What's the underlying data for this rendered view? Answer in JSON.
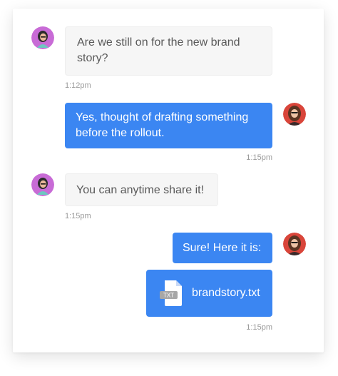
{
  "messages": [
    {
      "id": 1,
      "sender": "contact",
      "text": "Are we still on for the new brand story?",
      "time": "1:12pm"
    },
    {
      "id": 2,
      "sender": "me",
      "text": "Yes, thought of drafting something before the rollout.",
      "time": "1:15pm"
    },
    {
      "id": 3,
      "sender": "contact",
      "text": "You can anytime share it!",
      "time": "1:15pm"
    },
    {
      "id": 4,
      "sender": "me",
      "text": "Sure! Here it is:",
      "time": ""
    },
    {
      "id": 5,
      "sender": "me",
      "attachment": {
        "icon": "txt-file-icon",
        "badge": "TXT",
        "name": "brandstory.txt"
      },
      "time": "1:15pm"
    }
  ],
  "colors": {
    "outgoing_bubble": "#3b86f2",
    "incoming_bubble": "#f6f6f6",
    "incoming_text": "#595959",
    "timestamp": "#9a9a9a"
  }
}
